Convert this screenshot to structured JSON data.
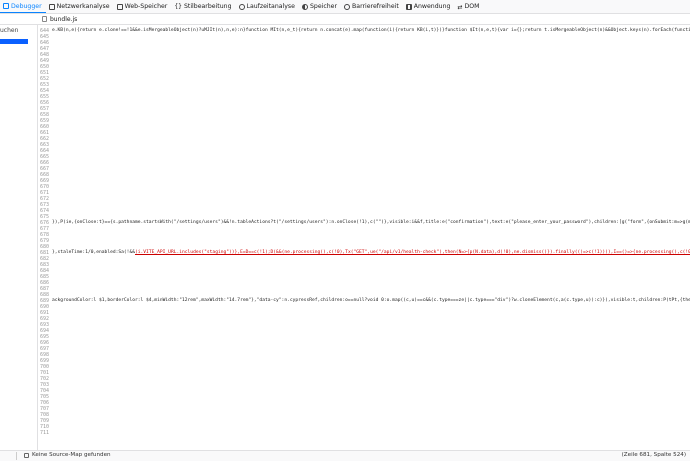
{
  "toolbar": {
    "tabs": [
      {
        "label": "Debugger",
        "icon": "debugger-icon"
      },
      {
        "label": "Netzwerkanalyse",
        "icon": "network-icon"
      },
      {
        "label": "Web-Speicher",
        "icon": "storage-icon"
      },
      {
        "label": "Stilbearbeitung",
        "icon": "style-editor-icon"
      },
      {
        "label": "Laufzeitanalyse",
        "icon": "performance-icon"
      },
      {
        "label": "Speicher",
        "icon": "memory-icon"
      },
      {
        "label": "Barrierefreiheit",
        "icon": "accessibility-icon"
      },
      {
        "label": "Anwendung",
        "icon": "application-icon"
      },
      {
        "label": "DOM",
        "icon": "dom-icon"
      }
    ],
    "accent": "#0a84ff"
  },
  "sidebar": {
    "search_label": "uchen"
  },
  "file_tab": {
    "label": "bundle.js"
  },
  "editor": {
    "line_numbers": [
      "644",
      "645",
      "646",
      "647",
      "648",
      "649",
      "650",
      "651",
      "652",
      "653",
      "654",
      "655",
      "656",
      "657",
      "658",
      "659",
      "660",
      "661",
      "662",
      "663",
      "664",
      "665",
      "666",
      "667",
      "668",
      "669",
      "670",
      "671",
      "672",
      "673",
      "674",
      "675",
      "676",
      "677",
      "678",
      "679",
      "680",
      "681",
      "682",
      "683",
      "684",
      "685",
      "686",
      "687",
      "688",
      "689",
      "690",
      "691",
      "692",
      "693",
      "694",
      "695",
      "696",
      "697",
      "698",
      "699",
      "700",
      "701",
      "702",
      "703",
      "704",
      "705",
      "706",
      "707",
      "708",
      "709",
      "710",
      "711"
    ],
    "code_lines": {
      "644": "e.KB(n,e){return e.clone!==!1&&e.isMergeableObject(n)?uMJIt(n),n,e):n}function MIt(n,e_t){return n.concat(e).map(function(i){return KB(i,t)})}function $It(n,e,t){var i={};return t.isMergeableObject(n)&&Object.keys(n).forEach(function(r){i[r]=KB(",
      "676": "}),P(ie,{onClose:t}=={s.pathname.startsWith(\"/settings/users\")&&!n.tableActions?t(\"/settings/users\"):n.onClose(!1),c(\"\")},visible:i&&f,title:e(\"confirmation\"),text:e(\"please_enter_your_password\"),children:[g(\"form\",{onSubmit:m=>g(m,!0),children:g(",
      "681_a": "},staleTime:1/0,enabled:Sa(!&&",
      "681_b": "(i.VITE_API_URL.includes(\"staging\"))},E=D==c(!1);D(&&(ne.processing(),c(!0),Tx(\"GET\",ue(\"/api/v1/health-check\"),then(N=>{p(N.data),d(!0),ne.dismiss()}).finally(()=>c(!1)))),I==()=>{ne.processing(),c(!0),Tx(\"GET\",",
      "689": "ackgroundColor:l $1,borderColor:l $4,minWidth:\"12rem\",maxWidth:\"14.7rem\"},\"data-cy\":n.cypressRef,children:o==null?void 0:o.map((c,u)==c&&(c.type===ze||c.type===\"div\")?w.cloneElement(c,a(c.type,u)):c)}),visible:t,children:P(tPt,{theme:{backgroundColor:"
    }
  },
  "status": {
    "source_map": "Keine Source-Map gefunden",
    "position": "(Zeile 681, Spalte 524)"
  }
}
